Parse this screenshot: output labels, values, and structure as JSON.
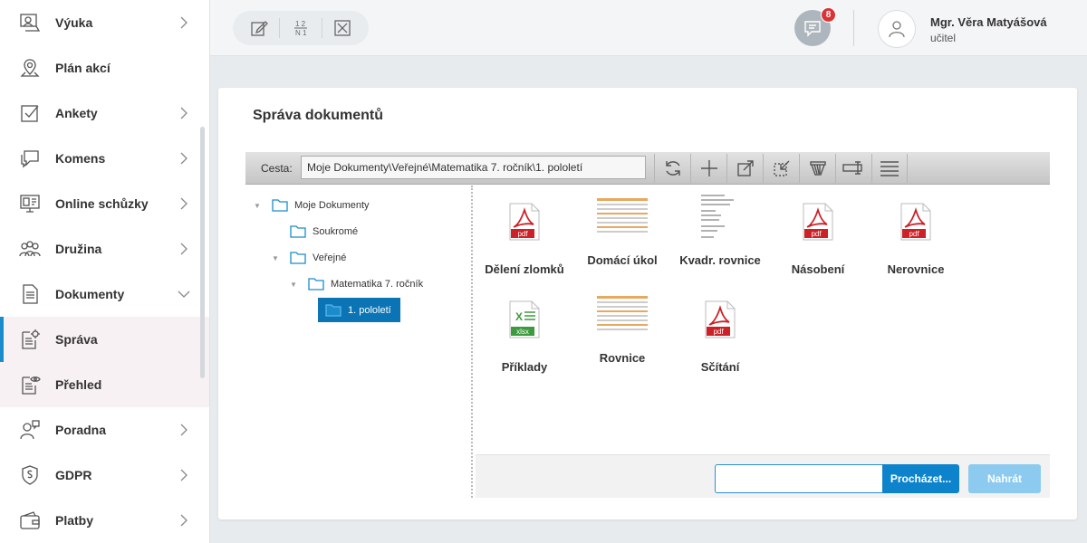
{
  "sidebar": {
    "items": [
      {
        "label": "Výuka",
        "icon": "teaching-icon",
        "has_arrow": true
      },
      {
        "label": "Plán akcí",
        "icon": "map-pin-icon",
        "has_arrow": false
      },
      {
        "label": "Ankety",
        "icon": "checkbox-icon",
        "has_arrow": true
      },
      {
        "label": "Komens",
        "icon": "chat-icon",
        "has_arrow": true
      },
      {
        "label": "Online schůzky",
        "icon": "video-meeting-icon",
        "has_arrow": true
      },
      {
        "label": "Družina",
        "icon": "group-icon",
        "has_arrow": true
      },
      {
        "label": "Dokumenty",
        "icon": "document-icon",
        "has_arrow": true,
        "expanded": true
      },
      {
        "label": "Správa",
        "icon": "document-settings-icon",
        "has_arrow": false,
        "active": true
      },
      {
        "label": "Přehled",
        "icon": "document-view-icon",
        "has_arrow": false
      },
      {
        "label": "Poradna",
        "icon": "counselling-icon",
        "has_arrow": true
      },
      {
        "label": "GDPR",
        "icon": "gdpr-icon",
        "has_arrow": true
      },
      {
        "label": "Platby",
        "icon": "wallet-icon",
        "has_arrow": true
      }
    ]
  },
  "topbar": {
    "tools": [
      "edit-icon",
      "fraction-icon",
      "close-box-icon"
    ],
    "messages_count": "8",
    "user_name": "Mgr. Věra Matyášová",
    "user_role": "učitel"
  },
  "panel": {
    "title": "Správa dokumentů",
    "path_label": "Cesta:",
    "path_value": "Moje Dokumenty\\Veřejné\\Matematika 7. ročník\\1. pololetí",
    "toolbar_icons": [
      "refresh-icon",
      "add-icon",
      "export-icon",
      "import-icon",
      "filter-icon",
      "rename-icon",
      "list-view-icon"
    ]
  },
  "tree": [
    {
      "label": "Moje Dokumenty",
      "level": 0
    },
    {
      "label": "Soukromé",
      "level": 1
    },
    {
      "label": "Veřejné",
      "level": 1
    },
    {
      "label": "Matematika 7. ročník",
      "level": 2
    },
    {
      "label": "1. pololetí",
      "level": 3,
      "selected": true
    }
  ],
  "files": [
    {
      "name": "Dělení zlomků",
      "type": "pdf"
    },
    {
      "name": "Domácí úkol",
      "type": "sheet-preview"
    },
    {
      "name": "Kvadr. rovnice",
      "type": "doc-preview"
    },
    {
      "name": "Násobení",
      "type": "pdf"
    },
    {
      "name": "Nerovnice",
      "type": "pdf"
    },
    {
      "name": "Příklady",
      "type": "xlsx"
    },
    {
      "name": "Rovnice",
      "type": "sheet-preview"
    },
    {
      "name": "Sčítání",
      "type": "pdf"
    }
  ],
  "upload": {
    "browse_label": "Procházet...",
    "upload_label": "Nahrát"
  },
  "colors": {
    "accent": "#0d83cc",
    "pdf_red": "#cc2127",
    "xlsx_green": "#3e9a3e",
    "badge": "#d93437"
  }
}
